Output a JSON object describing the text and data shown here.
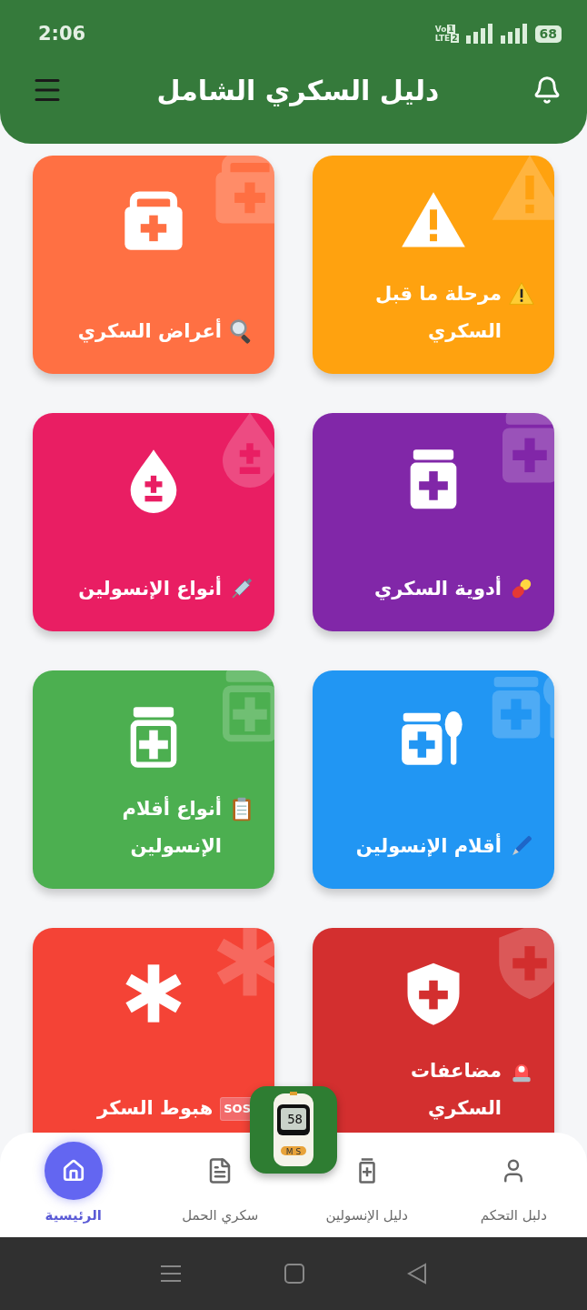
{
  "status_bar": {
    "time": "2:06",
    "network": [
      "Vo",
      "LTE"
    ],
    "sims": [
      "1",
      "2"
    ],
    "battery": "68"
  },
  "app_bar": {
    "title": "دليل السكري الشامل"
  },
  "cards": [
    {
      "kind": "prediabetes",
      "label": "مرحلة ما قبل السكري",
      "color": "#ffa20f"
    },
    {
      "kind": "symptoms",
      "label": "أعراض السكري",
      "color": "#ff7043"
    },
    {
      "kind": "medications",
      "label": "أدوية السكري",
      "color": "#8127a8"
    },
    {
      "kind": "insulin-types",
      "label": "أنواع الإنسولين",
      "color": "#e91e63"
    },
    {
      "kind": "pens",
      "label": "أقلام الإنسولين",
      "color": "#2196f3"
    },
    {
      "kind": "pen-types",
      "label": "أنواع أقلام الإنسولين",
      "color": "#4caf50"
    },
    {
      "kind": "complications",
      "label": "مضاعفات السكري",
      "color": "#d32f2f"
    },
    {
      "kind": "hypoglycemia",
      "label": "هبوط السكر",
      "badge": "SOS",
      "color": "#f44336"
    }
  ],
  "fab": {
    "reading": "58",
    "keys": "M S"
  },
  "bottom_nav": [
    {
      "kind": "user",
      "label": "دلبل التحكم",
      "selected": false
    },
    {
      "kind": "insulin",
      "label": "دليل الإنسولين",
      "selected": false
    },
    {
      "kind": "document",
      "label": "سكري الحمل",
      "selected": false
    },
    {
      "kind": "home",
      "label": "الرئيسية",
      "selected": true
    }
  ]
}
